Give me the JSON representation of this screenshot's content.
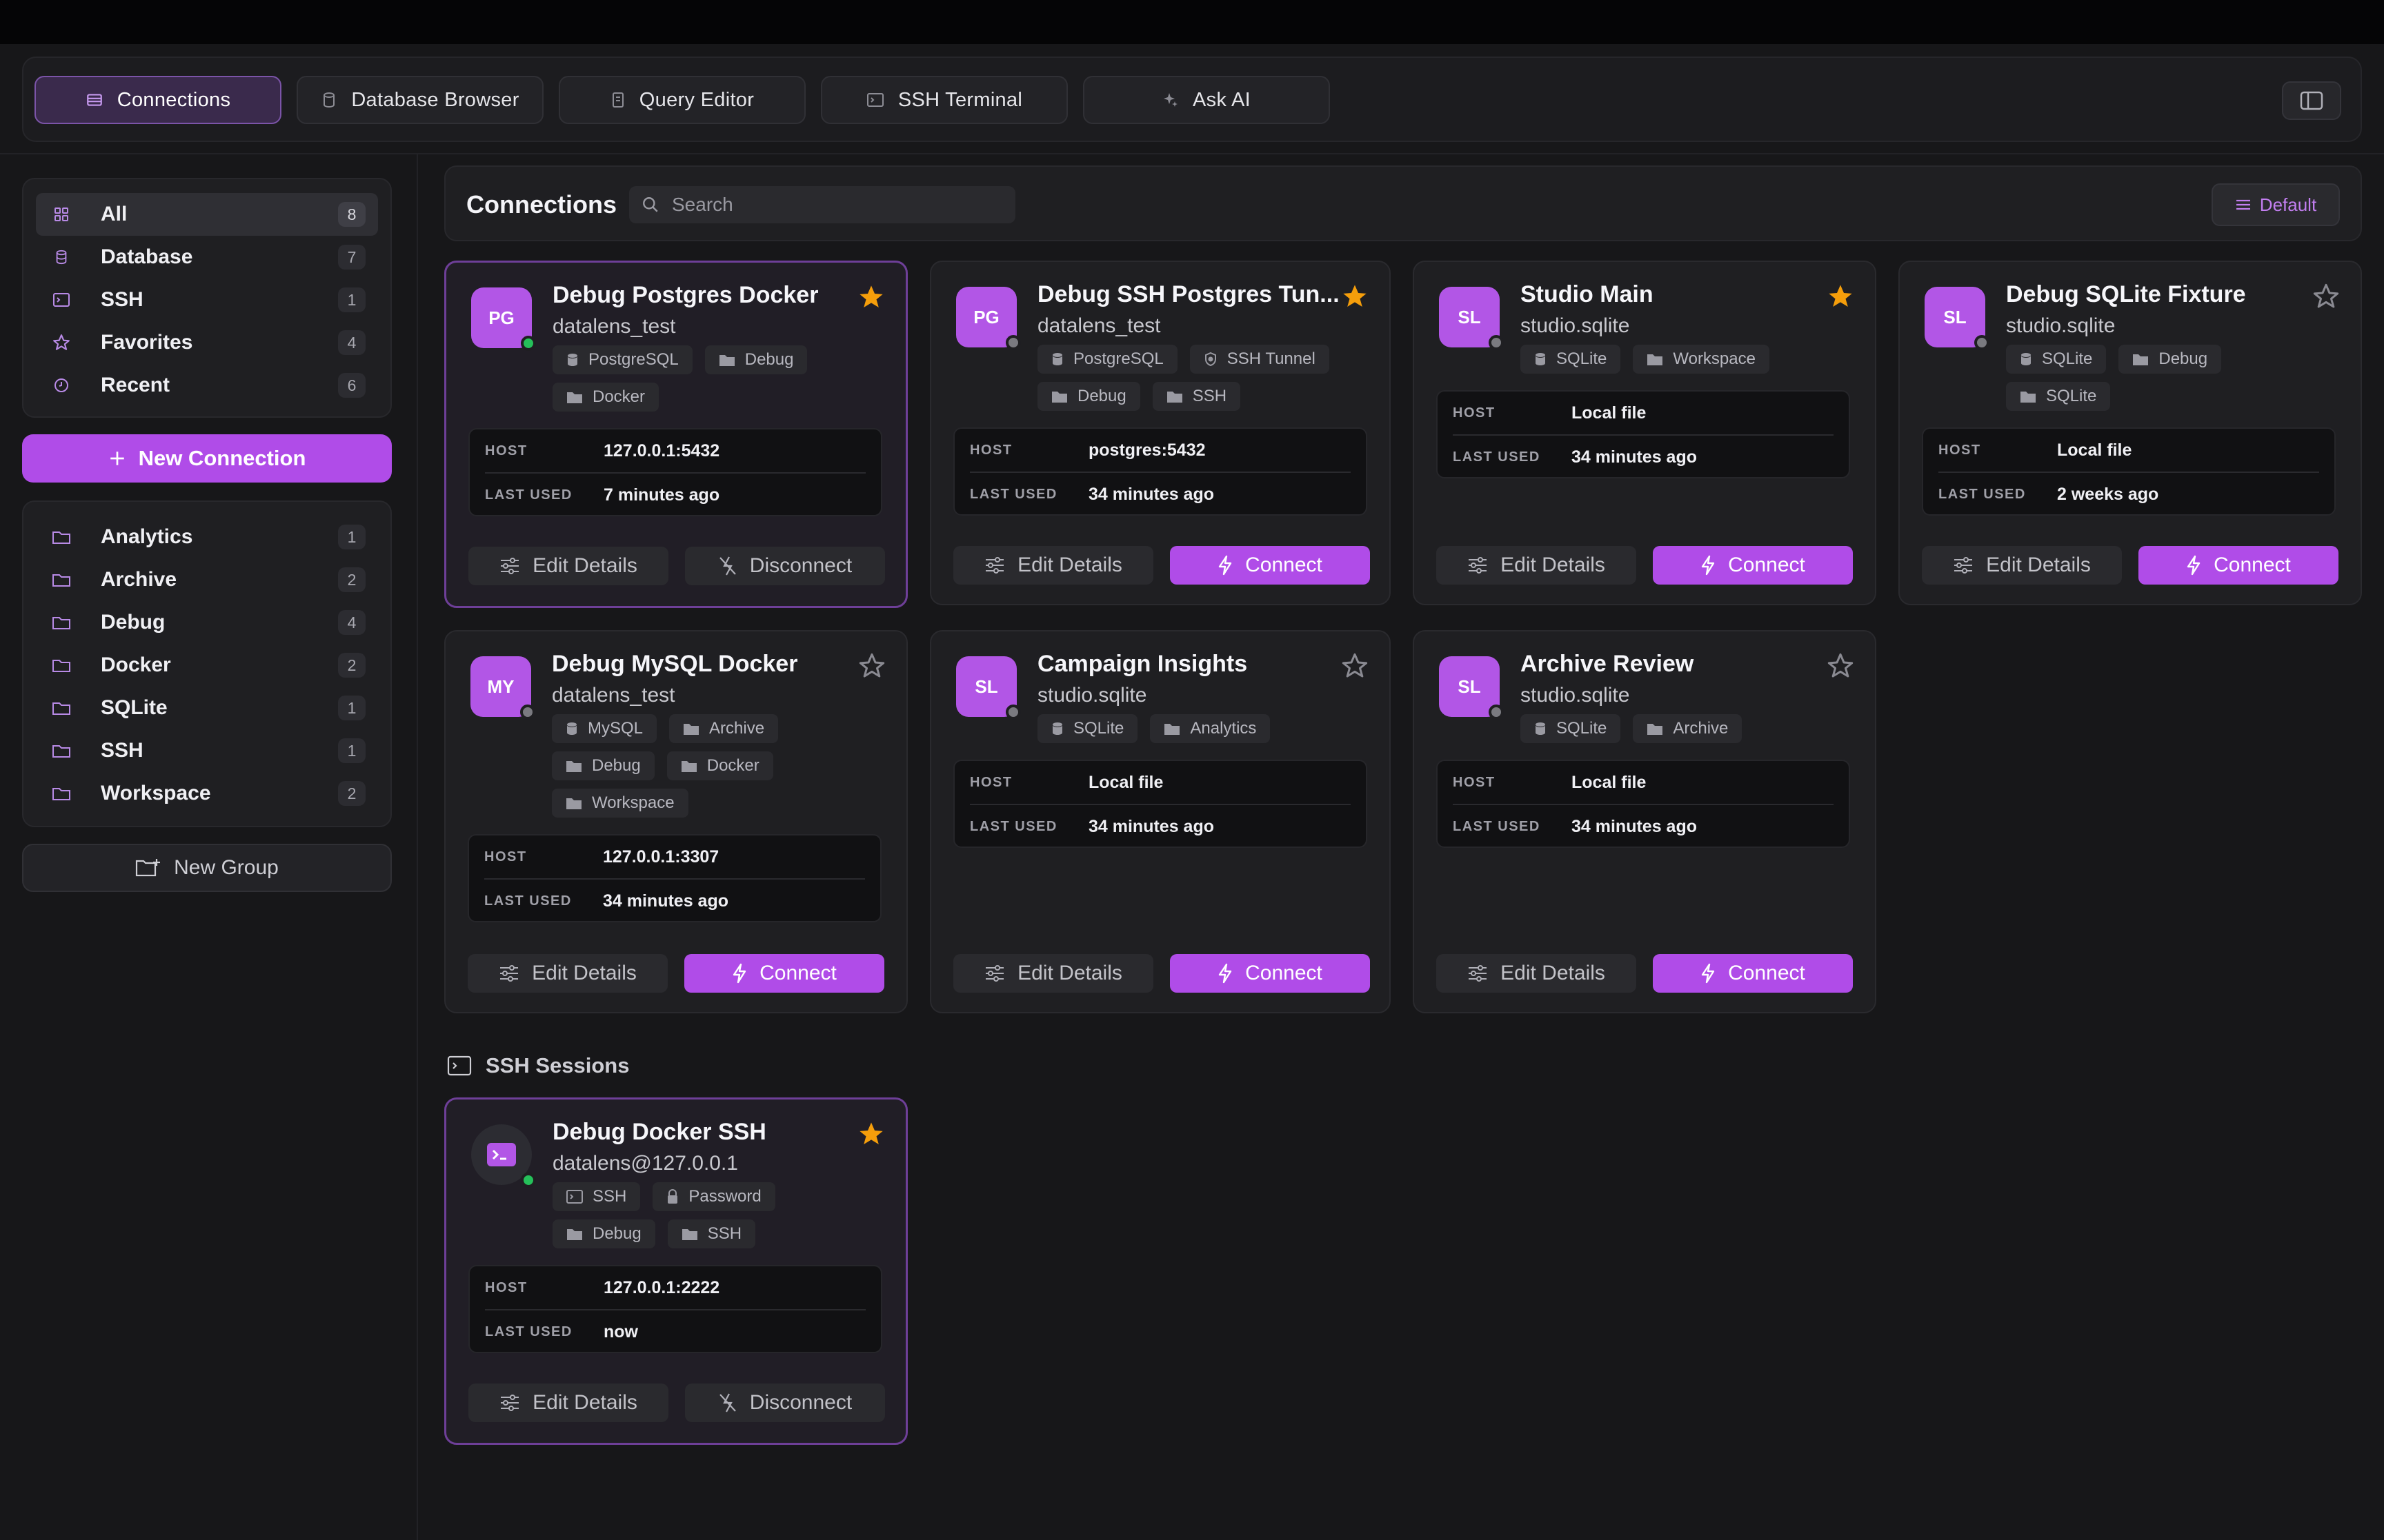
{
  "tabs": [
    {
      "label": "Connections",
      "icon": "database-icon"
    },
    {
      "label": "Database Browser",
      "icon": "cylinder-icon"
    },
    {
      "label": "Query Editor",
      "icon": "document-icon"
    },
    {
      "label": "SSH Terminal",
      "icon": "terminal-icon"
    },
    {
      "label": "Ask AI",
      "icon": "sparkle-icon"
    }
  ],
  "sidebar": {
    "filters": [
      {
        "label": "All",
        "count": "8",
        "icon": "grid-icon"
      },
      {
        "label": "Database",
        "count": "7",
        "icon": "database-icon"
      },
      {
        "label": "SSH",
        "count": "1",
        "icon": "terminal-icon"
      },
      {
        "label": "Favorites",
        "count": "4",
        "icon": "star-icon"
      },
      {
        "label": "Recent",
        "count": "6",
        "icon": "clock-icon"
      }
    ],
    "new_connection_label": "New Connection",
    "groups": [
      {
        "label": "Analytics",
        "count": "1"
      },
      {
        "label": "Archive",
        "count": "2"
      },
      {
        "label": "Debug",
        "count": "4"
      },
      {
        "label": "Docker",
        "count": "2"
      },
      {
        "label": "SQLite",
        "count": "1"
      },
      {
        "label": "SSH",
        "count": "1"
      },
      {
        "label": "Workspace",
        "count": "2"
      }
    ],
    "new_group_label": "New Group"
  },
  "header": {
    "title": "Connections",
    "search_placeholder": "Search",
    "sort_label": "Default"
  },
  "info_labels": {
    "host": "HOST",
    "last_used": "LAST USED"
  },
  "buttons": {
    "edit": "Edit Details",
    "connect": "Connect",
    "disconnect": "Disconnect"
  },
  "colors": {
    "accent": "#b04ce8",
    "favorite": "#f59e0b",
    "online": "#25c05a"
  },
  "connections": [
    {
      "avatar": "PG",
      "name": "Debug Postgres Docker",
      "sub": "datalens_test",
      "favorite": true,
      "connected": true,
      "tags": [
        "PostgreSQL",
        "Debug",
        "Docker"
      ],
      "tag_icons": [
        "database-icon",
        "folder-icon",
        "folder-icon"
      ],
      "host": "127.0.0.1:5432",
      "last_used": "7 minutes ago"
    },
    {
      "avatar": "PG",
      "name": "Debug SSH Postgres Tun...",
      "sub": "datalens_test",
      "favorite": true,
      "connected": false,
      "tags": [
        "PostgreSQL",
        "SSH Tunnel",
        "Debug",
        "SSH"
      ],
      "tag_icons": [
        "database-icon",
        "shield-icon",
        "folder-icon",
        "folder-icon"
      ],
      "host": "postgres:5432",
      "last_used": "34 minutes ago"
    },
    {
      "avatar": "SL",
      "name": "Studio Main",
      "sub": "studio.sqlite",
      "favorite": true,
      "connected": false,
      "tags": [
        "SQLite",
        "Workspace"
      ],
      "tag_icons": [
        "database-icon",
        "folder-icon"
      ],
      "host": "Local file",
      "last_used": "34 minutes ago"
    },
    {
      "avatar": "SL",
      "name": "Debug SQLite Fixture",
      "sub": "studio.sqlite",
      "favorite": false,
      "connected": false,
      "tags": [
        "SQLite",
        "Debug",
        "SQLite"
      ],
      "tag_icons": [
        "database-icon",
        "folder-icon",
        "folder-icon"
      ],
      "host": "Local file",
      "last_used": "2 weeks ago"
    },
    {
      "avatar": "MY",
      "name": "Debug MySQL Docker",
      "sub": "datalens_test",
      "favorite": false,
      "connected": false,
      "tags": [
        "MySQL",
        "Archive",
        "Debug",
        "Docker",
        "Workspace"
      ],
      "tag_icons": [
        "database-icon",
        "folder-icon",
        "folder-icon",
        "folder-icon",
        "folder-icon"
      ],
      "host": "127.0.0.1:3307",
      "last_used": "34 minutes ago"
    },
    {
      "avatar": "SL",
      "name": "Campaign Insights",
      "sub": "studio.sqlite",
      "favorite": false,
      "connected": false,
      "tags": [
        "SQLite",
        "Analytics"
      ],
      "tag_icons": [
        "database-icon",
        "folder-icon"
      ],
      "host": "Local file",
      "last_used": "34 minutes ago"
    },
    {
      "avatar": "SL",
      "name": "Archive Review",
      "sub": "studio.sqlite",
      "favorite": false,
      "connected": false,
      "tags": [
        "SQLite",
        "Archive"
      ],
      "tag_icons": [
        "database-icon",
        "folder-icon"
      ],
      "host": "Local file",
      "last_used": "34 minutes ago"
    }
  ],
  "ssh_section": {
    "title": "SSH Sessions",
    "sessions": [
      {
        "avatar": "ssh",
        "name": "Debug Docker SSH",
        "sub": "datalens@127.0.0.1",
        "favorite": true,
        "connected": true,
        "tags": [
          "SSH",
          "Password",
          "Debug",
          "SSH"
        ],
        "tag_icons": [
          "terminal-icon",
          "lock-icon",
          "folder-icon",
          "folder-icon"
        ],
        "host": "127.0.0.1:2222",
        "last_used": "now"
      }
    ]
  }
}
